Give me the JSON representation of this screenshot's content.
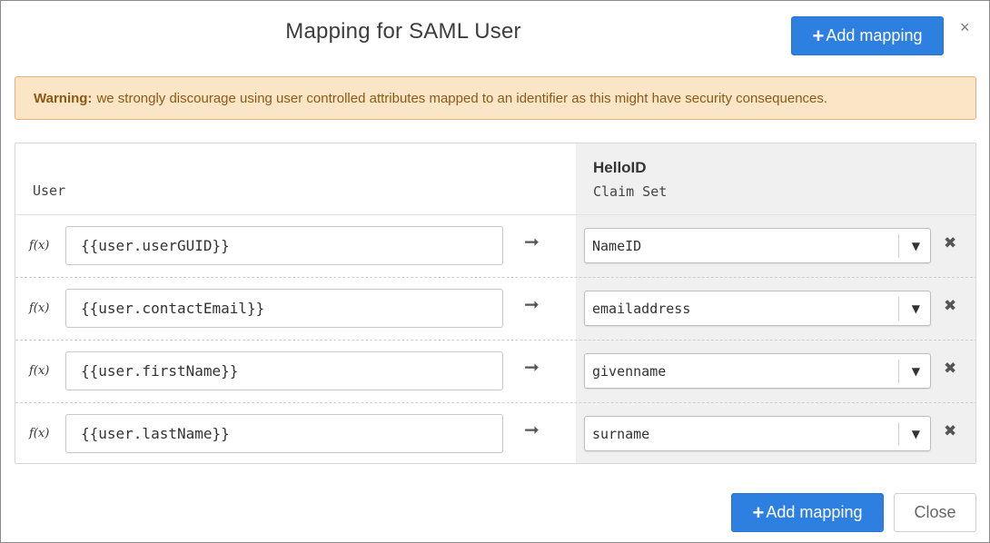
{
  "dialog": {
    "title": "Mapping for SAML User",
    "add_mapping_label": "Add mapping",
    "close_icon_glyph": "×",
    "close_label": "Close"
  },
  "warning": {
    "label": "Warning:",
    "text": "we strongly discourage using user controlled attributes mapped to an identifier as this might have security consequences."
  },
  "table": {
    "left_header": "User",
    "right_header_title": "HelloID",
    "right_header_sub": "Claim Set",
    "fx_label": "f(x)",
    "arrow_glyph": "➞",
    "remove_glyph": "✖",
    "caret_glyph": "▼",
    "rows": [
      {
        "expression": "{{user.userGUID}}",
        "claim": "NameID"
      },
      {
        "expression": "{{user.contactEmail}}",
        "claim": "emailaddress"
      },
      {
        "expression": "{{user.firstName}}",
        "claim": "givenname"
      },
      {
        "expression": "{{user.lastName}}",
        "claim": "surname"
      }
    ]
  },
  "colors": {
    "primary": "#2d7fe0",
    "warning_bg": "#fbe5c7",
    "warning_border": "#e7b27a",
    "warning_text": "#8a5a14",
    "claim_column_bg": "#f0f0f0"
  }
}
